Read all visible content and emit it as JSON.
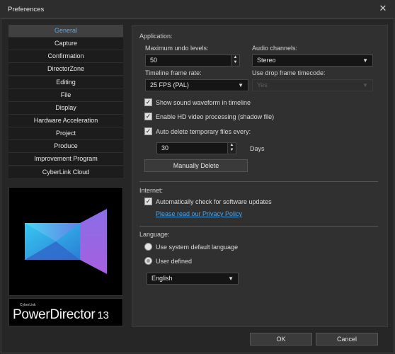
{
  "window": {
    "title": "Preferences",
    "close_icon": "close-icon"
  },
  "nav": {
    "items": [
      {
        "label": "General",
        "active": true
      },
      {
        "label": "Capture"
      },
      {
        "label": "Confirmation"
      },
      {
        "label": "DirectorZone"
      },
      {
        "label": "Editing"
      },
      {
        "label": "File"
      },
      {
        "label": "Display"
      },
      {
        "label": "Hardware Acceleration"
      },
      {
        "label": "Project"
      },
      {
        "label": "Produce"
      },
      {
        "label": "Improvement Program"
      },
      {
        "label": "CyberLink Cloud"
      }
    ]
  },
  "brand": {
    "company": "CyberLink",
    "product": "PowerDirector",
    "version": "13"
  },
  "application": {
    "section_label": "Application:",
    "undo_label": "Maximum undo levels:",
    "undo_value": "50",
    "audio_label": "Audio channels:",
    "audio_value": "Stereo",
    "framerate_label": "Timeline frame rate:",
    "framerate_value": "25 FPS (PAL)",
    "dropframe_label": "Use drop frame timecode:",
    "dropframe_value": "Yes",
    "waveform_label": "Show sound waveform in timeline",
    "hd_label": "Enable HD video processing (shadow file)",
    "autodelete_label": "Auto delete temporary files every:",
    "days_value": "30",
    "days_label": "Days",
    "manual_delete": "Manually Delete"
  },
  "internet": {
    "section_label": "Internet:",
    "updates_label": "Automatically check for software updates",
    "privacy_link": "Please read our Privacy Policy"
  },
  "language": {
    "section_label": "Language:",
    "system_label": "Use system default language",
    "user_label": "User defined",
    "selected": "English"
  },
  "footer": {
    "ok": "OK",
    "cancel": "Cancel"
  },
  "colors": {
    "accent": "#5aa8e0",
    "link": "#4ea3e6",
    "background": "#262626"
  }
}
